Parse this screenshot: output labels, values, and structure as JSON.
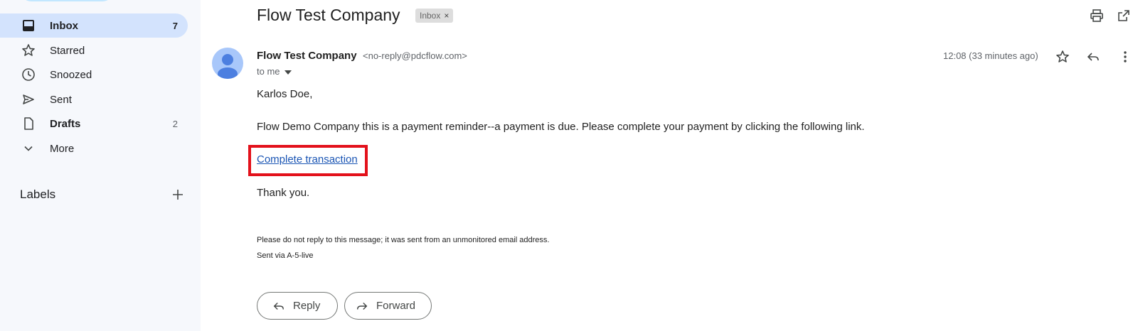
{
  "sidebar": {
    "items": [
      {
        "label": "Inbox",
        "count": "7",
        "icon": "inbox-icon"
      },
      {
        "label": "Starred",
        "count": "",
        "icon": "star-icon"
      },
      {
        "label": "Snoozed",
        "count": "",
        "icon": "clock-icon"
      },
      {
        "label": "Sent",
        "count": "",
        "icon": "send-icon"
      },
      {
        "label": "Drafts",
        "count": "2",
        "icon": "draft-icon"
      },
      {
        "label": "More",
        "count": "",
        "icon": "chevron-down-icon"
      }
    ],
    "labels_title": "Labels"
  },
  "email": {
    "subject": "Flow Test Company",
    "chip_label": "Inbox",
    "chip_remove": "×",
    "sender_name": "Flow Test Company",
    "sender_email": "<no-reply@pdcflow.com>",
    "recipient": "to me",
    "timestamp": "12:08 (33 minutes ago)",
    "greeting": "Karlos Doe,",
    "paragraph": "Flow Demo Company this is a payment reminder--a payment is due. Please complete your payment by clicking the following link.",
    "link_text": "Complete transaction",
    "closing": "Thank you.",
    "footer_line1": "Please do not reply to this message; it was sent from an unmonitored email address.",
    "footer_line2": "Sent via A-5-live"
  },
  "actions": {
    "reply_label": "Reply",
    "forward_label": "Forward"
  },
  "colors": {
    "sidebar_bg": "#f6f8fc",
    "active_nav": "#d3e3fd",
    "link": "#1a55b4",
    "highlight_box": "#e3111b",
    "avatar": "#a8c7fa"
  }
}
